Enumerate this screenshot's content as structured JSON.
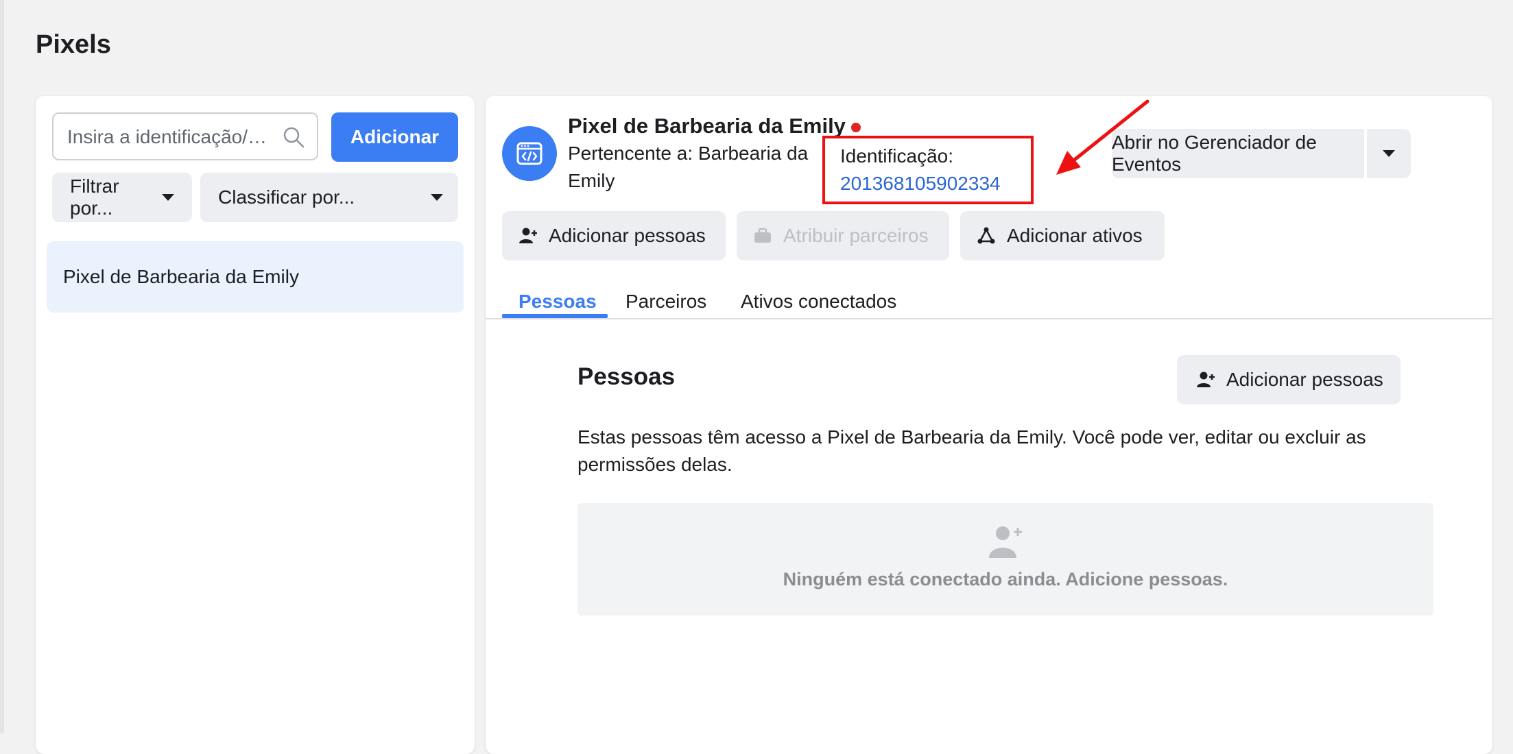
{
  "page": {
    "title": "Pixels"
  },
  "left_panel": {
    "search": {
      "placeholder": "Insira a identificação/…"
    },
    "add_label": "Adicionar",
    "filter_label": "Filtrar por...",
    "sort_label": "Classificar por...",
    "items": [
      {
        "label": "Pixel de Barbearia da Emily"
      }
    ]
  },
  "detail": {
    "name": "Pixel de Barbearia da Emily",
    "owner_text": "Pertencente a: Barbearia da Emily",
    "id_label": "Identificação:",
    "id_value": "201368105902334",
    "open_events_label": "Abrir no Gerenciador de Eventos",
    "actions": {
      "add_people": "Adicionar pessoas",
      "assign_partners": "Atribuir parceiros",
      "add_assets": "Adicionar ativos"
    },
    "tabs": [
      {
        "label": "Pessoas"
      },
      {
        "label": "Parceiros"
      },
      {
        "label": "Ativos conectados"
      }
    ],
    "people": {
      "title": "Pessoas",
      "add_button": "Adicionar pessoas",
      "description": "Estas pessoas têm acesso a Pixel de Barbearia da Emily. Você pode ver, editar ou excluir as permissões delas.",
      "empty": "Ninguém está conectado ainda. Adicione pessoas."
    }
  },
  "colors": {
    "accent": "#3b7df2",
    "highlight_box": "#ee1111",
    "status_dot": "#e02424",
    "id_link": "#2a66d6"
  }
}
